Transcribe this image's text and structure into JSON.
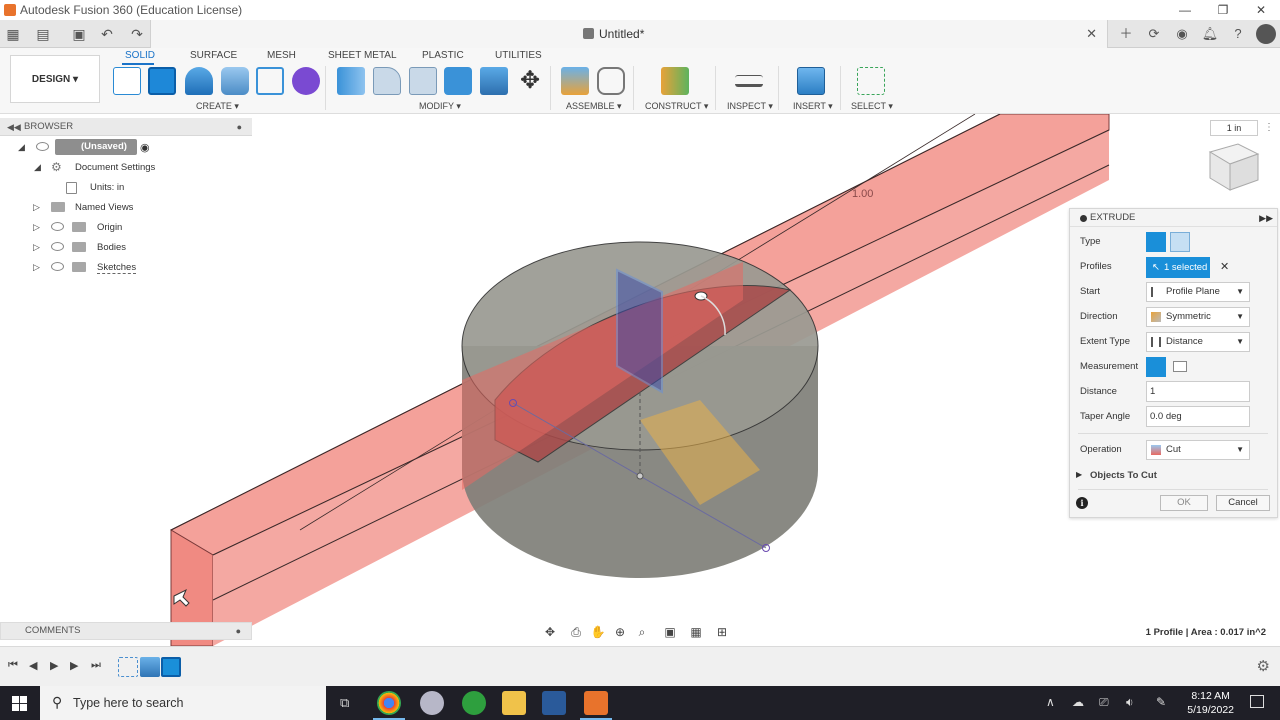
{
  "window": {
    "title": "Autodesk Fusion 360 (Education License)",
    "minimize": "—",
    "restore": "❐",
    "close": "✕"
  },
  "document": {
    "name": "Untitled*",
    "close": "✕"
  },
  "ribbon": {
    "workspace": "DESIGN ▾",
    "tabs": [
      "SOLID",
      "SURFACE",
      "MESH",
      "SHEET METAL",
      "PLASTIC",
      "UTILITIES"
    ],
    "groups": [
      "CREATE ▾",
      "MODIFY ▾",
      "ASSEMBLE ▾",
      "CONSTRUCT ▾",
      "INSPECT ▾",
      "INSERT ▾",
      "SELECT ▾"
    ]
  },
  "browser": {
    "title": "BROWSER",
    "root": "(Unsaved)",
    "document_settings": "Document Settings",
    "units": "Units: in",
    "items": [
      "Named Views",
      "Origin",
      "Bodies",
      "Sketches"
    ]
  },
  "comments": {
    "title": "COMMENTS"
  },
  "viewport": {
    "dimension_label": "1.00",
    "unit_box": "1 in",
    "colors": {
      "extrude_red": "#f08080",
      "cylinder_gray": "#8a8a80",
      "profile_blue": "#6a8fd6"
    }
  },
  "extrude": {
    "title": "EXTRUDE",
    "rows": {
      "type": "Type",
      "profiles": "Profiles",
      "start": "Start",
      "direction": "Direction",
      "extent_type": "Extent Type",
      "measurement": "Measurement",
      "distance": "Distance",
      "taper_angle": "Taper Angle",
      "operation": "Operation"
    },
    "profiles_value": "1 selected",
    "start_value": "Profile Plane",
    "direction_value": "Symmetric",
    "extent_value": "Distance",
    "distance_value": "1",
    "taper_value": "0.0 deg",
    "operation_value": "Cut",
    "objects_to_cut": "Objects To Cut",
    "ok": "OK",
    "cancel": "Cancel",
    "accent": "#1a8fd9"
  },
  "status": {
    "profile_area": "1 Profile | Area : 0.017 in^2"
  },
  "taskbar": {
    "search_placeholder": "Type here to search",
    "time": "8:12 AM",
    "date": "5/19/2022"
  }
}
